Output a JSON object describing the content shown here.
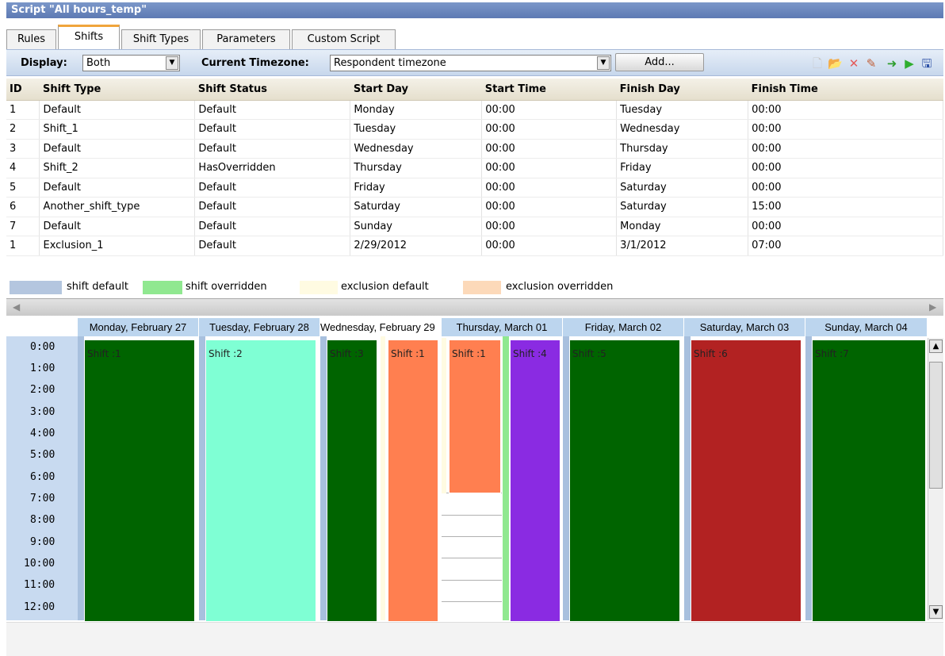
{
  "window": {
    "title": "Script \"All hours_temp\""
  },
  "tabs": [
    {
      "label": "Rules",
      "active": false
    },
    {
      "label": "Shifts",
      "active": true
    },
    {
      "label": "Shift Types",
      "active": false
    },
    {
      "label": "Parameters",
      "active": false
    },
    {
      "label": "Custom Script",
      "active": false
    }
  ],
  "toolbar": {
    "display_label": "Display:",
    "display_value": "Both",
    "timezone_label": "Current Timezone:",
    "timezone_value": "Respondent timezone",
    "add_label": "Add..."
  },
  "table": {
    "headers": [
      "ID",
      "Shift Type",
      "Shift Status",
      "Start Day",
      "Start Time",
      "Finish Day",
      "Finish Time"
    ],
    "rows": [
      [
        "1",
        "Default",
        "Default",
        "Monday",
        "00:00",
        "Tuesday",
        "00:00"
      ],
      [
        "2",
        "Shift_1",
        "Default",
        "Tuesday",
        "00:00",
        "Wednesday",
        "00:00"
      ],
      [
        "3",
        "Default",
        "Default",
        "Wednesday",
        "00:00",
        "Thursday",
        "00:00"
      ],
      [
        "4",
        "Shift_2",
        "HasOverridden",
        "Thursday",
        "00:00",
        "Friday",
        "00:00"
      ],
      [
        "5",
        "Default",
        "Default",
        "Friday",
        "00:00",
        "Saturday",
        "00:00"
      ],
      [
        "6",
        "Another_shift_type",
        "Default",
        "Saturday",
        "00:00",
        "Saturday",
        "15:00"
      ],
      [
        "7",
        "Default",
        "Default",
        "Sunday",
        "00:00",
        "Monday",
        "00:00"
      ],
      [
        "1",
        "Exclusion_1",
        "Default",
        "2/29/2012",
        "00:00",
        "3/1/2012",
        "07:00"
      ]
    ]
  },
  "legend": [
    {
      "label": "shift default",
      "color": "#b4c6df"
    },
    {
      "label": "shift overridden",
      "color": "#90e890"
    },
    {
      "label": "exclusion default",
      "color": "#fffbe2"
    },
    {
      "label": "exclusion overridden",
      "color": "#fcd9b9"
    }
  ],
  "calendar": {
    "days": [
      "Monday, February 27",
      "Tuesday, February 28",
      "Wednesday, February 29",
      "Thursday, March 01",
      "Friday, March 02",
      "Saturday, March 03",
      "Sunday, March 04"
    ],
    "active_day": "Wednesday, February 29",
    "times": [
      "0:00",
      "1:00",
      "2:00",
      "3:00",
      "4:00",
      "5:00",
      "6:00",
      "7:00",
      "8:00",
      "9:00",
      "10:00",
      "11:00",
      "12:00"
    ],
    "shifts": [
      {
        "label": "Shift :1",
        "color": "#006400"
      },
      {
        "label": "Shift :2",
        "color": "#7fffd4"
      },
      {
        "label": "Shift :3",
        "color": "#006400"
      },
      {
        "label": "Shift :1",
        "color": "#ff7f50"
      },
      {
        "label": "Shift :1",
        "color": "#ff7f50"
      },
      {
        "label": "Shift :4",
        "color": "#8a2be2"
      },
      {
        "label": "Shift :5",
        "color": "#006400"
      },
      {
        "label": "Shift :6",
        "color": "#b22222"
      },
      {
        "label": "Shift :7",
        "color": "#006400"
      }
    ]
  }
}
